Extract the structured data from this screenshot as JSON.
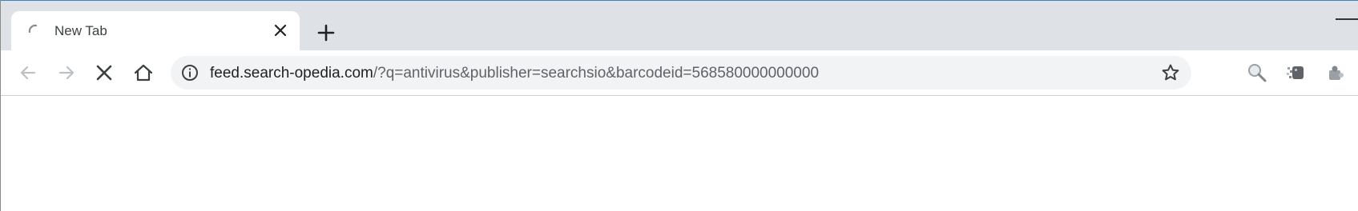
{
  "browser": {
    "tab": {
      "title": "New Tab",
      "loading": true
    },
    "address_bar": {
      "host": "feed.search-opedia.com",
      "path": "/?q=antivirus&publisher=searchsio&barcodeid=568580000000000"
    },
    "icons": {
      "back": "arrow-left-icon",
      "forward": "arrow-right-icon",
      "stop": "close-icon",
      "home": "home-icon",
      "info": "info-icon",
      "bookmark": "star-icon",
      "extensions": [
        "search-extension-icon",
        "pixelated-extension-icon",
        "puzzle-extension-icon"
      ]
    },
    "colors": {
      "tabstrip": "#dee1e6",
      "omnibox": "#f1f3f4",
      "window_border": "#3b7fc4",
      "disabled_icon": "#bdc1c6",
      "active_icon": "#3c4043"
    }
  }
}
